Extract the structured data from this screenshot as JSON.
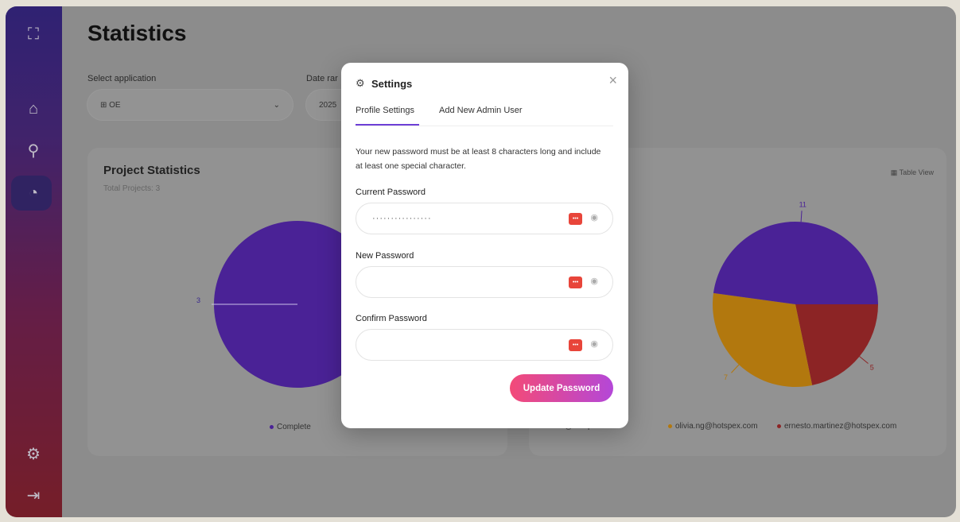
{
  "app": {
    "page_title": "Statistics"
  },
  "sidebar": {
    "items": [
      {
        "name": "logo-icon",
        "glyph": "⛶"
      },
      {
        "name": "home-icon",
        "glyph": "⌂"
      },
      {
        "name": "user-search-icon",
        "glyph": "⚲"
      },
      {
        "name": "pie-chart-icon",
        "glyph": "◔"
      },
      {
        "name": "settings-icon",
        "glyph": "⚙"
      },
      {
        "name": "logout-icon",
        "glyph": "⇥"
      }
    ]
  },
  "filters": {
    "app_label": "Select application",
    "app_value": "⊞ OE",
    "date_label": "Date rar",
    "date_value": "2025"
  },
  "project_card": {
    "title": "Project Statistics",
    "subtitle": "Total Projects: 3",
    "slice_label": "3",
    "legend": "Complete"
  },
  "user_card": {
    "table_view": "Table View",
    "labels": [
      "11",
      "7",
      "5"
    ],
    "legend": [
      "…@hotspex.com",
      "olivia.ng@hotspex.com",
      "ernesto.martinez@hotspex.com"
    ]
  },
  "colors": {
    "purple": "#4a2296",
    "orange": "#b2780e",
    "red": "#8c2425"
  },
  "chart_data": [
    {
      "type": "pie",
      "title": "Project Statistics",
      "categories": [
        "Complete"
      ],
      "values": [
        3
      ]
    },
    {
      "type": "pie",
      "categories": [
        "…@hotspex.com",
        "olivia.ng@hotspex.com",
        "ernesto.martinez@hotspex.com"
      ],
      "values": [
        11,
        7,
        5
      ]
    }
  ],
  "modal": {
    "title": "Settings",
    "close": "×",
    "tabs": [
      "Profile Settings",
      "Add New Admin User"
    ],
    "description": "Your new password must be at least 8 characters long and include at least one special character.",
    "fields": [
      {
        "label": "Current Password",
        "value": "················"
      },
      {
        "label": "New Password",
        "value": ""
      },
      {
        "label": "Confirm Password",
        "value": ""
      }
    ],
    "submit": "Update Password"
  }
}
